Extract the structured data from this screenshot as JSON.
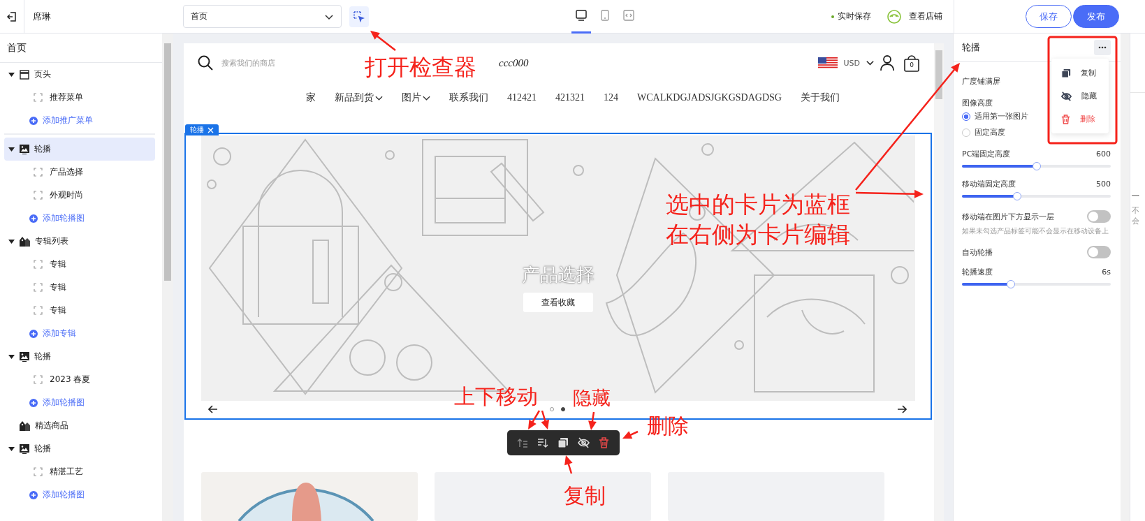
{
  "top_bar": {
    "store_name": "席琳",
    "page_select": {
      "value": "首页"
    },
    "devices": [
      {
        "kind": "desktop",
        "selected": true
      },
      {
        "kind": "tablet",
        "selected": false
      },
      {
        "kind": "code",
        "selected": false
      }
    ],
    "save_status": "实时保存",
    "view_store": "查看店铺",
    "buttons": [
      {
        "label": "保存",
        "kind": "secondary"
      },
      {
        "label": "发布",
        "kind": "primary"
      }
    ]
  },
  "sidebar": {
    "title": "首页",
    "sections": [
      {
        "label": "页头",
        "kind": "header",
        "expanded": true,
        "selected": false,
        "children": [
          "推荐菜单"
        ],
        "add_label": "添加推广菜单"
      },
      {
        "label": "轮播",
        "kind": "image",
        "expanded": true,
        "selected": true,
        "children": [
          "产品选择",
          "外观时尚"
        ],
        "add_label": "添加轮播图"
      },
      {
        "label": "专辑列表",
        "kind": "collection",
        "expanded": true,
        "selected": false,
        "children": [
          "专辑",
          "专辑",
          "专辑"
        ],
        "add_label": "添加专辑"
      },
      {
        "label": "轮播",
        "kind": "image",
        "expanded": true,
        "selected": false,
        "children": [
          "2023 春夏"
        ],
        "add_label": "添加轮播图"
      },
      {
        "label": "精选商品",
        "kind": "collection",
        "selected": false
      },
      {
        "label": "轮播",
        "kind": "image",
        "expanded": true,
        "selected": false,
        "children": [
          "精湛工艺"
        ],
        "add_label": "添加轮播图"
      }
    ]
  },
  "preview": {
    "search_placeholder": "搜索我们的商店",
    "logo": "ccc000",
    "currency": "USD",
    "cart_count": "0",
    "nav": [
      {
        "label": "家",
        "dropdown": false
      },
      {
        "label": "新品到货",
        "dropdown": true
      },
      {
        "label": "图片",
        "dropdown": true
      },
      {
        "label": "联系我们",
        "dropdown": false
      },
      {
        "label": "412421",
        "dropdown": false
      },
      {
        "label": "421321",
        "dropdown": false
      },
      {
        "label": "124",
        "dropdown": false
      },
      {
        "label": "WCALKDGJADSJGKGSDAGDSG",
        "dropdown": false
      },
      {
        "label": "关于我们",
        "dropdown": false
      }
    ],
    "block_tag": "轮播",
    "slide": {
      "title": "产品选择",
      "button": "查看收藏"
    },
    "dots": [
      {
        "selected": false
      },
      {
        "selected": true
      }
    ]
  },
  "right_panel": {
    "title": "轮播",
    "menu": [
      {
        "label": "复制",
        "kind": "copy"
      },
      {
        "label": "隐藏",
        "kind": "hide"
      },
      {
        "label": "删除",
        "kind": "delete"
      }
    ],
    "settings": [
      {
        "kind": "label",
        "label": "广度铺满屏"
      },
      {
        "kind": "radio",
        "label": "图像高度",
        "options": [
          {
            "label": "适用第一张图片",
            "selected": true
          },
          {
            "label": "固定高度",
            "selected": false
          }
        ]
      },
      {
        "kind": "slider",
        "label": "PC端固定高度",
        "reading": "600",
        "level": 0.5
      },
      {
        "kind": "slider",
        "label": "移动端固定高度",
        "reading": "500",
        "level": 0.37
      },
      {
        "kind": "toggle",
        "label": "移动端在图片下方显示一层",
        "on": false,
        "hint": "如果未勾选产品标签可能不会显示在移动设备上"
      },
      {
        "kind": "toggle",
        "label": "自动轮播",
        "on": false
      },
      {
        "kind": "slider",
        "label": "轮播速度",
        "reading": "6s",
        "level": 0.33
      }
    ]
  },
  "right_strip": {
    "texts": [
      "一",
      "不会"
    ]
  },
  "annotations": [
    {
      "kind": "inspector",
      "lines": [
        "打开检查器"
      ]
    },
    {
      "kind": "selection",
      "lines": [
        "选中的卡片为蓝框",
        "在右侧为卡片编辑"
      ]
    },
    {
      "kind": "move",
      "lines": [
        "上下移动"
      ]
    },
    {
      "kind": "hide",
      "lines": [
        "隐藏"
      ]
    },
    {
      "kind": "delete",
      "lines": [
        "删除"
      ]
    },
    {
      "kind": "copy",
      "lines": [
        "复制"
      ]
    }
  ]
}
